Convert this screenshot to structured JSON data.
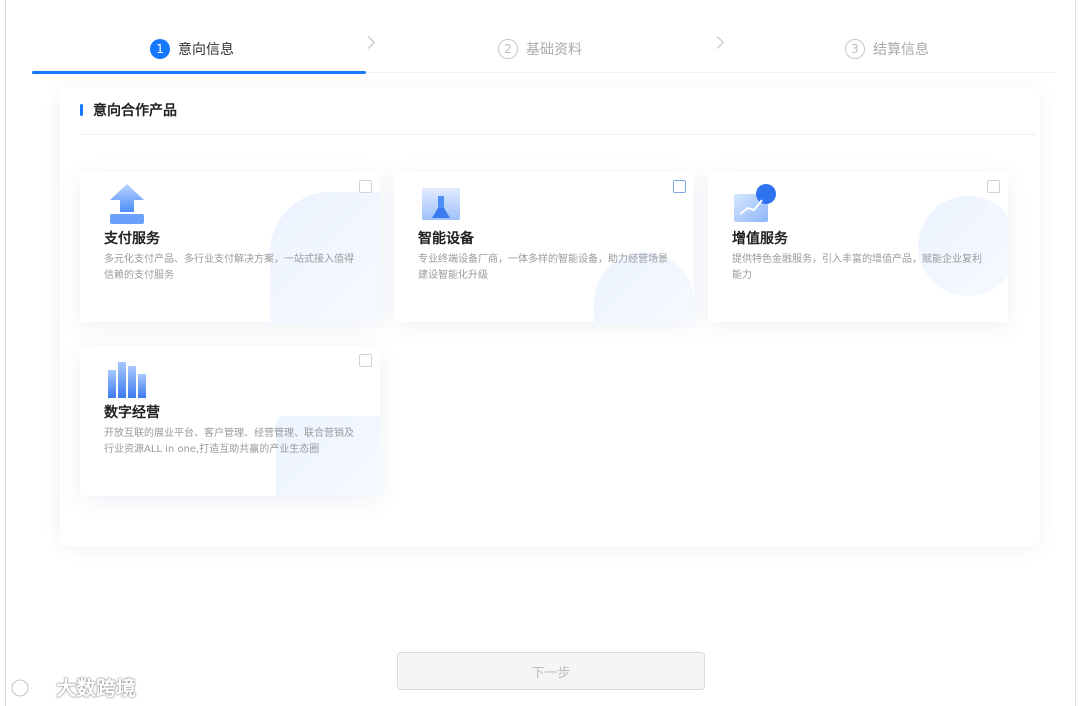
{
  "steps": [
    {
      "num": "1",
      "label": "意向信息",
      "state": "active"
    },
    {
      "num": "2",
      "label": "基础资料",
      "state": "inactive"
    },
    {
      "num": "3",
      "label": "结算信息",
      "state": "inactive"
    }
  ],
  "section": {
    "title": "意向合作产品"
  },
  "products": [
    {
      "title": "支付服务",
      "desc": "多元化支付产品、多行业支付解决方案，一站式接入值得信赖的支付服务",
      "icon": "payment-upload-icon",
      "checked": false
    },
    {
      "title": "智能设备",
      "desc": "专业终端设备厂商，一体多样的智能设备，助力经营场景建设智能化升级",
      "icon": "smart-device-icon",
      "checked": false
    },
    {
      "title": "增值服务",
      "desc": "提供特色金融服务，引入丰富的增值产品，赋能企业复利能力",
      "icon": "growth-chart-icon",
      "checked": false
    },
    {
      "title": "数字经营",
      "desc": "开放互联的展业平台、客户管理、经营管理、联合营销及行业资源ALL in one,打造互助共赢的产业生态圈",
      "icon": "bar-chart-icon",
      "checked": false
    }
  ],
  "next_button": {
    "label": "下一步"
  },
  "watermark": {
    "text": "大数跨境"
  },
  "colors": {
    "accent": "#1677ff",
    "muted": "#bdbdbd"
  }
}
